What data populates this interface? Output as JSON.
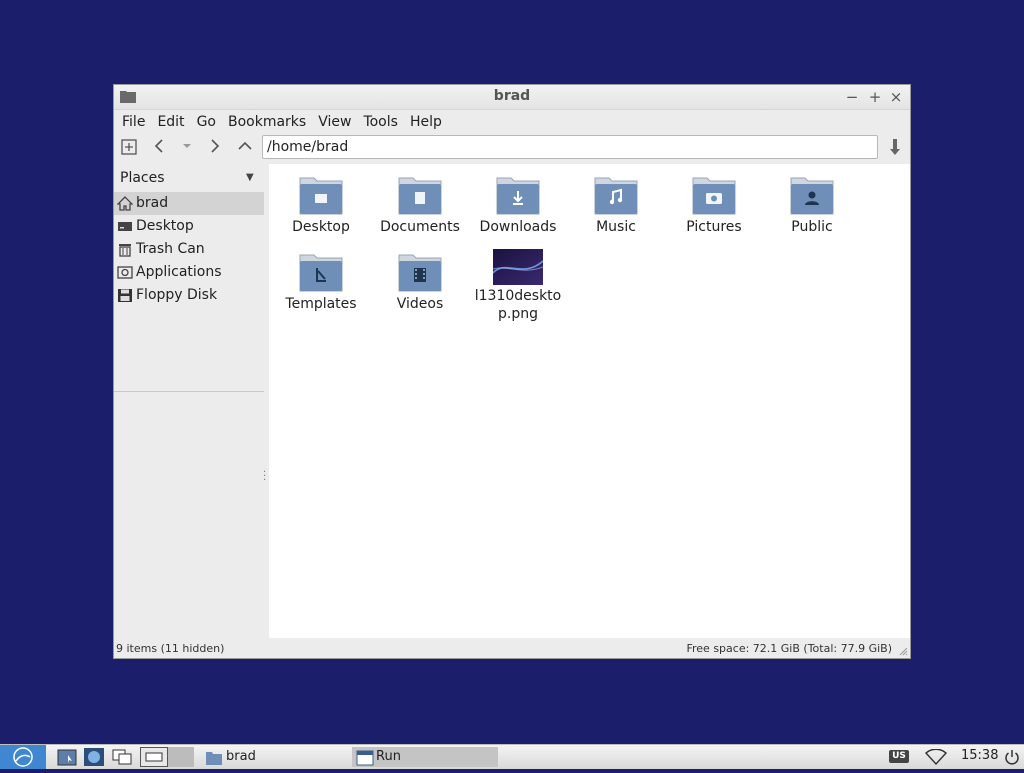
{
  "window": {
    "title": "brad",
    "minimize": "−",
    "maximize": "+",
    "close": "×"
  },
  "menubar": [
    "File",
    "Edit",
    "Go",
    "Bookmarks",
    "View",
    "Tools",
    "Help"
  ],
  "toolbar": {
    "path": "/home/brad"
  },
  "sidebar": {
    "header": "Places",
    "items": [
      {
        "label": "brad",
        "icon": "home-icon"
      },
      {
        "label": "Desktop",
        "icon": "desktop-icon"
      },
      {
        "label": "Trash Can",
        "icon": "trash-icon"
      },
      {
        "label": "Applications",
        "icon": "applications-icon"
      },
      {
        "label": "Floppy Disk",
        "icon": "floppy-disk-icon"
      }
    ]
  },
  "files": [
    {
      "name": "Desktop",
      "icon": "folder-desktop-icon"
    },
    {
      "name": "Documents",
      "icon": "folder-documents-icon"
    },
    {
      "name": "Downloads",
      "icon": "folder-downloads-icon"
    },
    {
      "name": "Music",
      "icon": "folder-music-icon"
    },
    {
      "name": "Pictures",
      "icon": "folder-pictures-icon"
    },
    {
      "name": "Public",
      "icon": "folder-public-icon"
    },
    {
      "name": "Templates",
      "icon": "folder-templates-icon"
    },
    {
      "name": "Videos",
      "icon": "folder-videos-icon"
    },
    {
      "name": "l1310desktop.png",
      "icon": "image-file-icon"
    }
  ],
  "status": {
    "items": "9 items (11 hidden)",
    "free_space": "Free space: 72.1 GiB (Total: 77.9 GiB)"
  },
  "taskbar": {
    "window1": "brad",
    "window2": "Run",
    "keyboard": "US",
    "clock": "15:38"
  },
  "colors": {
    "desktop": "#1b1f6b",
    "folder": "#6f8fb8",
    "selected": "#d3d3d3"
  }
}
